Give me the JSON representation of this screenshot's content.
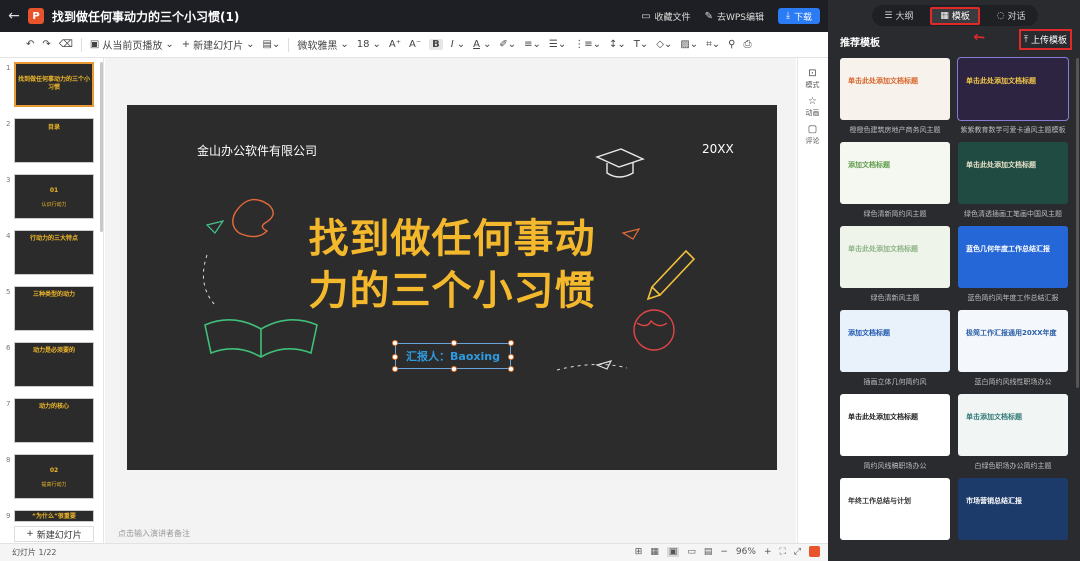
{
  "app": {
    "logo_letter": "P",
    "doc_title": "找到做任何事动力的三个小习惯(1)",
    "actions": [
      {
        "label": "收藏文件",
        "icon": "bookmark-icon"
      },
      {
        "label": "去WPS编辑",
        "icon": "edit-icon"
      }
    ],
    "download_label": "下载"
  },
  "toolbar": {
    "play_label": "从当前页播放",
    "new_slide_label": "新建幻灯片",
    "font_name": "微软雅黑",
    "font_size": "18"
  },
  "thumbnails": [
    {
      "num": "1",
      "title": "找到做任何事动力的三个小习惯",
      "sub": ""
    },
    {
      "num": "2",
      "title": "目录",
      "sub": ""
    },
    {
      "num": "3",
      "title": "01",
      "sub": "认识行动力"
    },
    {
      "num": "4",
      "title": "行动力的三大特点",
      "sub": ""
    },
    {
      "num": "5",
      "title": "三种类型的动力",
      "sub": ""
    },
    {
      "num": "6",
      "title": "动力是必须要的",
      "sub": ""
    },
    {
      "num": "7",
      "title": "动力的核心",
      "sub": ""
    },
    {
      "num": "8",
      "title": "02",
      "sub": "提高行动力"
    },
    {
      "num": "9",
      "title": "“为什么”很重要",
      "sub": ""
    }
  ],
  "new_slide_button": "新建幻灯片",
  "slide": {
    "company": "金山办公软件有限公司",
    "year": "20XX",
    "headline_line1": "找到做任何事动",
    "headline_line2": "力的三个小习惯",
    "reporter": "汇报人：Baoxing"
  },
  "notes_placeholder": "点击输入演讲者备注",
  "side_tools": [
    {
      "label": "模式",
      "icon": "mode-icon"
    },
    {
      "label": "动画",
      "icon": "star-icon"
    },
    {
      "label": "评论",
      "icon": "comment-icon"
    }
  ],
  "status": {
    "slide_count": "幻灯片 1/22",
    "zoom": "96%"
  },
  "right_panel": {
    "tabs": [
      {
        "label": "大纲",
        "icon": "list-icon"
      },
      {
        "label": "模板",
        "icon": "template-icon"
      },
      {
        "label": "对话",
        "icon": "chat-icon"
      }
    ],
    "heading": "推荐模板",
    "upload_label": "上传模板",
    "templates": [
      {
        "title": "单击此处添加文档标题",
        "caption": "橙橙色建筑房地产商务风主题",
        "bg": "#f7f2ec",
        "fg": "#d7642a"
      },
      {
        "title": "单击此处添加文档标题",
        "caption": "紫紫教育数学可爱卡通风主题模板",
        "bg": "#2c2440",
        "fg": "#f4c84a"
      },
      {
        "title": "添加文档标题",
        "caption": "绿色清新简约风主题",
        "bg": "#f5f7f1",
        "fg": "#5e9b4a"
      },
      {
        "title": "单击此处添加文档标题",
        "caption": "绿色清透插画工笔画中国风主题",
        "bg": "#1f4b43",
        "fg": "#e6e2c9"
      },
      {
        "title": "单击此处添加文档标题",
        "caption": "绿色清新风主题",
        "bg": "#eef4ea",
        "fg": "#8fb487"
      },
      {
        "title": "蓝色几何年度工作总结汇报",
        "caption": "蓝色简约风年度工作总结汇报",
        "bg": "#2667d8",
        "fg": "#ffffff"
      },
      {
        "title": "添加文档标题",
        "caption": "插画立体几何简约风",
        "bg": "#e9f2fb",
        "fg": "#1e56b0"
      },
      {
        "title": "极简工作汇报通用20XX年度",
        "caption": "蓝白简约风线性职场办公",
        "bg": "#f4f7fb",
        "fg": "#2b5fa8"
      },
      {
        "title": "单击此处添加文档标题",
        "caption": "简约风线稿职场办公",
        "bg": "#ffffff",
        "fg": "#222222"
      },
      {
        "title": "单击添加文档标题",
        "caption": "白绿色职场办公简约主题",
        "bg": "#f1f5f4",
        "fg": "#2f7a78"
      },
      {
        "title": "年终工作总结与计划",
        "caption": "",
        "bg": "#ffffff",
        "fg": "#333333"
      },
      {
        "title": "市场营销总结汇报",
        "caption": "",
        "bg": "#1c3b6a",
        "fg": "#ffffff"
      }
    ]
  }
}
